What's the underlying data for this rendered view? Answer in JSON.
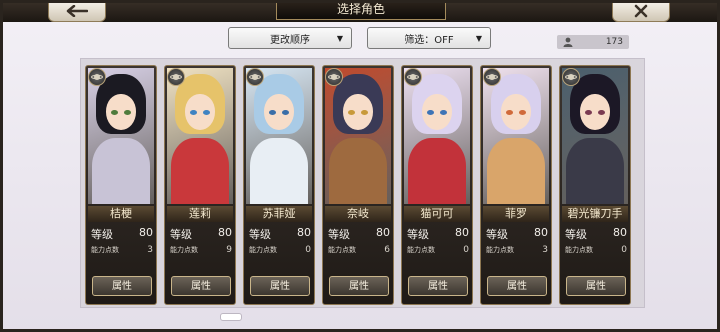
{
  "title": "选择角色",
  "sort_label": "更改顺序",
  "filter_label": "筛选：OFF",
  "character_count": "173",
  "icons": {
    "back": "arrow-left-icon",
    "close": "close-icon",
    "user": "person-icon",
    "badge": "saturn-emblem-icon",
    "dropdown": "triangle-down-icon"
  },
  "characters": [
    {
      "name": "桔梗",
      "level_label": "等级",
      "level": "80",
      "points_label": "能力点数",
      "points": "3",
      "attr_label": "属性",
      "palette": {
        "bg": "#d7d0e6",
        "hair": "#1b1a22",
        "body": "#c8c3d6",
        "eye": "#4f7b3c"
      }
    },
    {
      "name": "莲莉",
      "level_label": "等级",
      "level": "80",
      "points_label": "能力点数",
      "points": "9",
      "attr_label": "属性",
      "palette": {
        "bg": "#f0e2c2",
        "hair": "#e6c36a",
        "body": "#c9383b",
        "eye": "#3f83c2"
      }
    },
    {
      "name": "苏菲娅",
      "level_label": "等级",
      "level": "80",
      "points_label": "能力点数",
      "points": "0",
      "attr_label": "属性",
      "palette": {
        "bg": "#d6e6f3",
        "hair": "#a9cbe6",
        "body": "#e8eef4",
        "eye": "#3a6ea8"
      }
    },
    {
      "name": "奈岐",
      "level_label": "等级",
      "level": "80",
      "points_label": "能力点数",
      "points": "6",
      "attr_label": "属性",
      "palette": {
        "bg": "#c04a2d",
        "hair": "#3a3a56",
        "body": "#9e6a3f",
        "eye": "#c89a3a"
      }
    },
    {
      "name": "猫可可",
      "level_label": "等级",
      "level": "80",
      "points_label": "能力点数",
      "points": "0",
      "attr_label": "属性",
      "palette": {
        "bg": "#ecdff0",
        "hair": "#dcd3ef",
        "body": "#c2323a",
        "eye": "#3d74b6"
      }
    },
    {
      "name": "菲罗",
      "level_label": "等级",
      "level": "80",
      "points_label": "能力点数",
      "points": "3",
      "attr_label": "属性",
      "palette": {
        "bg": "#efe1ee",
        "hair": "#d8d0ee",
        "body": "#d9a56a",
        "eye": "#d06a3a"
      }
    },
    {
      "name": "碧光镰刀手",
      "level_label": "等级",
      "level": "80",
      "points_label": "能力点数",
      "points": "0",
      "attr_label": "属性",
      "palette": {
        "bg": "#4a5e6c",
        "hair": "#1c1826",
        "body": "#3a3a48",
        "eye": "#7a3a52"
      }
    }
  ]
}
